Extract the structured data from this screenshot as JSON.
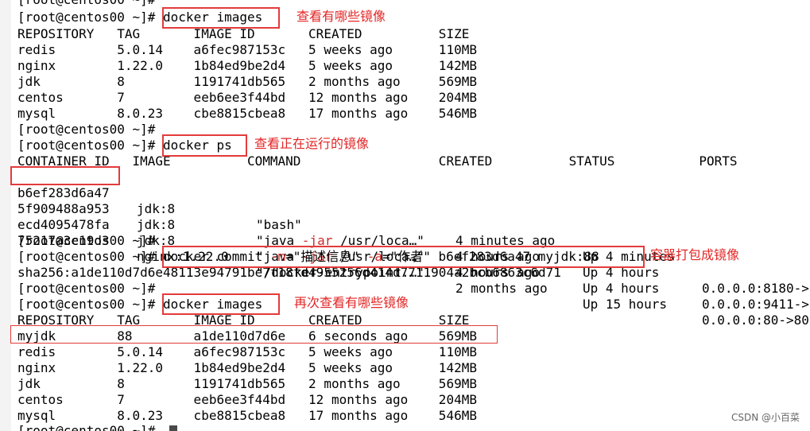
{
  "terminal": {
    "top_partial": "[root@centos00 ~]#",
    "prompt": "[root@centos00 ~]# ",
    "prompt_bare": "[root@centos00 ~]#",
    "cmd1": "docker images",
    "images_header": "REPOSITORY   TAG       IMAGE ID       CREATED          SIZE",
    "images_rows": [
      "redis        5.0.14    a6fec987153c   5 weeks ago      110MB",
      "nginx        1.22.0    1b84ed9be2d4   5 weeks ago      142MB",
      "jdk          8         1191741db565   2 months ago     569MB",
      "centos       7         eeb6ee3f44bd   12 months ago    204MB",
      "mysql        8.0.23    cbe8815cbea8   17 months ago    546MB"
    ],
    "cmd2": "docker ps",
    "ps_header": "CONTAINER ID   IMAGE          COMMAND                  CREATED          STATUS           PORTS",
    "ps_rows": [
      {
        "id": "b6ef283d6a47",
        "image": "jdk:8",
        "cmd_pre": "\"bash\"",
        "cmd_opt": "",
        "cmd_post": "",
        "created": "4 minutes ago",
        "status": "Up 4 minutes",
        "ports": ""
      },
      {
        "id": "5f909488a953",
        "image": "jdk:8",
        "cmd_pre": "\"java ",
        "cmd_opt": "-jar",
        "cmd_post": " /usr/loca…\"",
        "created": "4 hours ago",
        "status": "Up 4 hours",
        "ports": "0.0.0.0:8180->"
      },
      {
        "id": "ecd4095478fa",
        "image": "jdk:8",
        "cmd_pre": "\"java ",
        "cmd_opt": "-jar",
        "cmd_post": " /usr/loca…\"",
        "created": "4 hours ago",
        "status": "Up 4 hours",
        "ports": "0.0.0.0:9411->"
      },
      {
        "id": "75217a3c19d3",
        "image": "nginx:1.22.0",
        "cmd_pre": "\"/docker-entrypoint.…\"",
        "cmd_opt": "",
        "cmd_post": "",
        "created": "2 months ago",
        "status": "Up 15 hours",
        "ports": "0.0.0.0:80->80"
      }
    ],
    "cmd3_a": "docker commit ",
    "cmd3_m": "-m",
    "cmd3_b": "=\"描述信息\" ",
    "cmd3_a2": "-a",
    "cmd3_c": "=\"作者\" b6ef283d6a47 myjdk:88",
    "sha": "sha256:a1de110d7d6e48113e94791be7f18fd4955256d414d7711904a2bcb6863c6d71",
    "cmd4": "docker images",
    "images2_rows": [
      "myjdk        88        a1de110d7d6e   6 seconds ago    569MB",
      "redis        5.0.14    a6fec987153c   5 weeks ago      110MB",
      "nginx        1.22.0    1b84ed9be2d4   5 weeks ago      142MB",
      "jdk          8         1191741db565   2 months ago     569MB",
      "centos       7         eeb6ee3f44bd   12 months ago    204MB",
      "mysql        8.0.23    cbe8815cbea8   17 months ago    546MB"
    ],
    "bottom_partial": "[root@centos00 ~]#"
  },
  "annotations": {
    "a1": "查看有哪些镜像",
    "a2": "查看正在运行的镜像",
    "a3": "容器打包成镜像",
    "a4": "再次查看有哪些镜像"
  },
  "watermark": "CSDN @小百菜",
  "colors": {
    "highlight": "#e33b3b",
    "annotation_text": "#e32626",
    "option_flag": "#cc2a2a"
  }
}
